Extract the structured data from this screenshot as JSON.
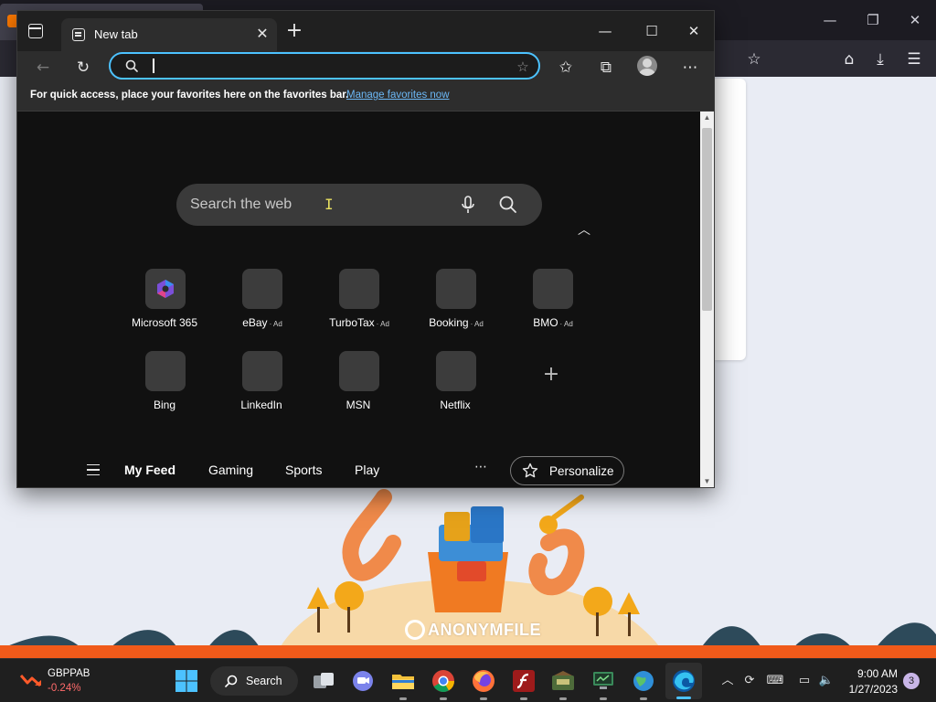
{
  "edge": {
    "tab_title": "New tab",
    "address_placeholder": "",
    "favorites_message": "For quick access, place your favorites here on the favorites bar.",
    "favorites_link": "Manage favorites now"
  },
  "ntp": {
    "search_placeholder": "Search the web",
    "tiles": [
      {
        "label": "Microsoft 365",
        "ad": ""
      },
      {
        "label": "eBay",
        "ad": "· Ad"
      },
      {
        "label": "TurboTax",
        "ad": "· Ad"
      },
      {
        "label": "Booking",
        "ad": "· Ad"
      },
      {
        "label": "BMO",
        "ad": "· Ad"
      },
      {
        "label": "Bing",
        "ad": ""
      },
      {
        "label": "LinkedIn",
        "ad": ""
      },
      {
        "label": "MSN",
        "ad": ""
      },
      {
        "label": "Netflix",
        "ad": ""
      }
    ],
    "feed_tabs": [
      "My Feed",
      "Gaming",
      "Sports",
      "Play"
    ],
    "personalize_label": "Personalize"
  },
  "background": {
    "brand_text": "ANONYMFILE"
  },
  "taskbar": {
    "ticker_name": "GBPPAB",
    "ticker_change": "-0.24%",
    "search_label": "Search",
    "time": "9:00 AM",
    "date": "1/27/2023",
    "notification_count": "3"
  },
  "colors": {
    "accent_focus": "#4cc2ff",
    "link": "#6cb8f6",
    "ntp_background": "#111111",
    "ticker_negative": "#ff6b6b"
  },
  "icons": {
    "edge_tab_actions": "tab-actions-icon",
    "refresh": "refresh-icon",
    "favorites": "favorites-icon",
    "collections": "collections-icon",
    "more": "more-icon",
    "mic": "microphone-icon",
    "search": "search-icon"
  }
}
